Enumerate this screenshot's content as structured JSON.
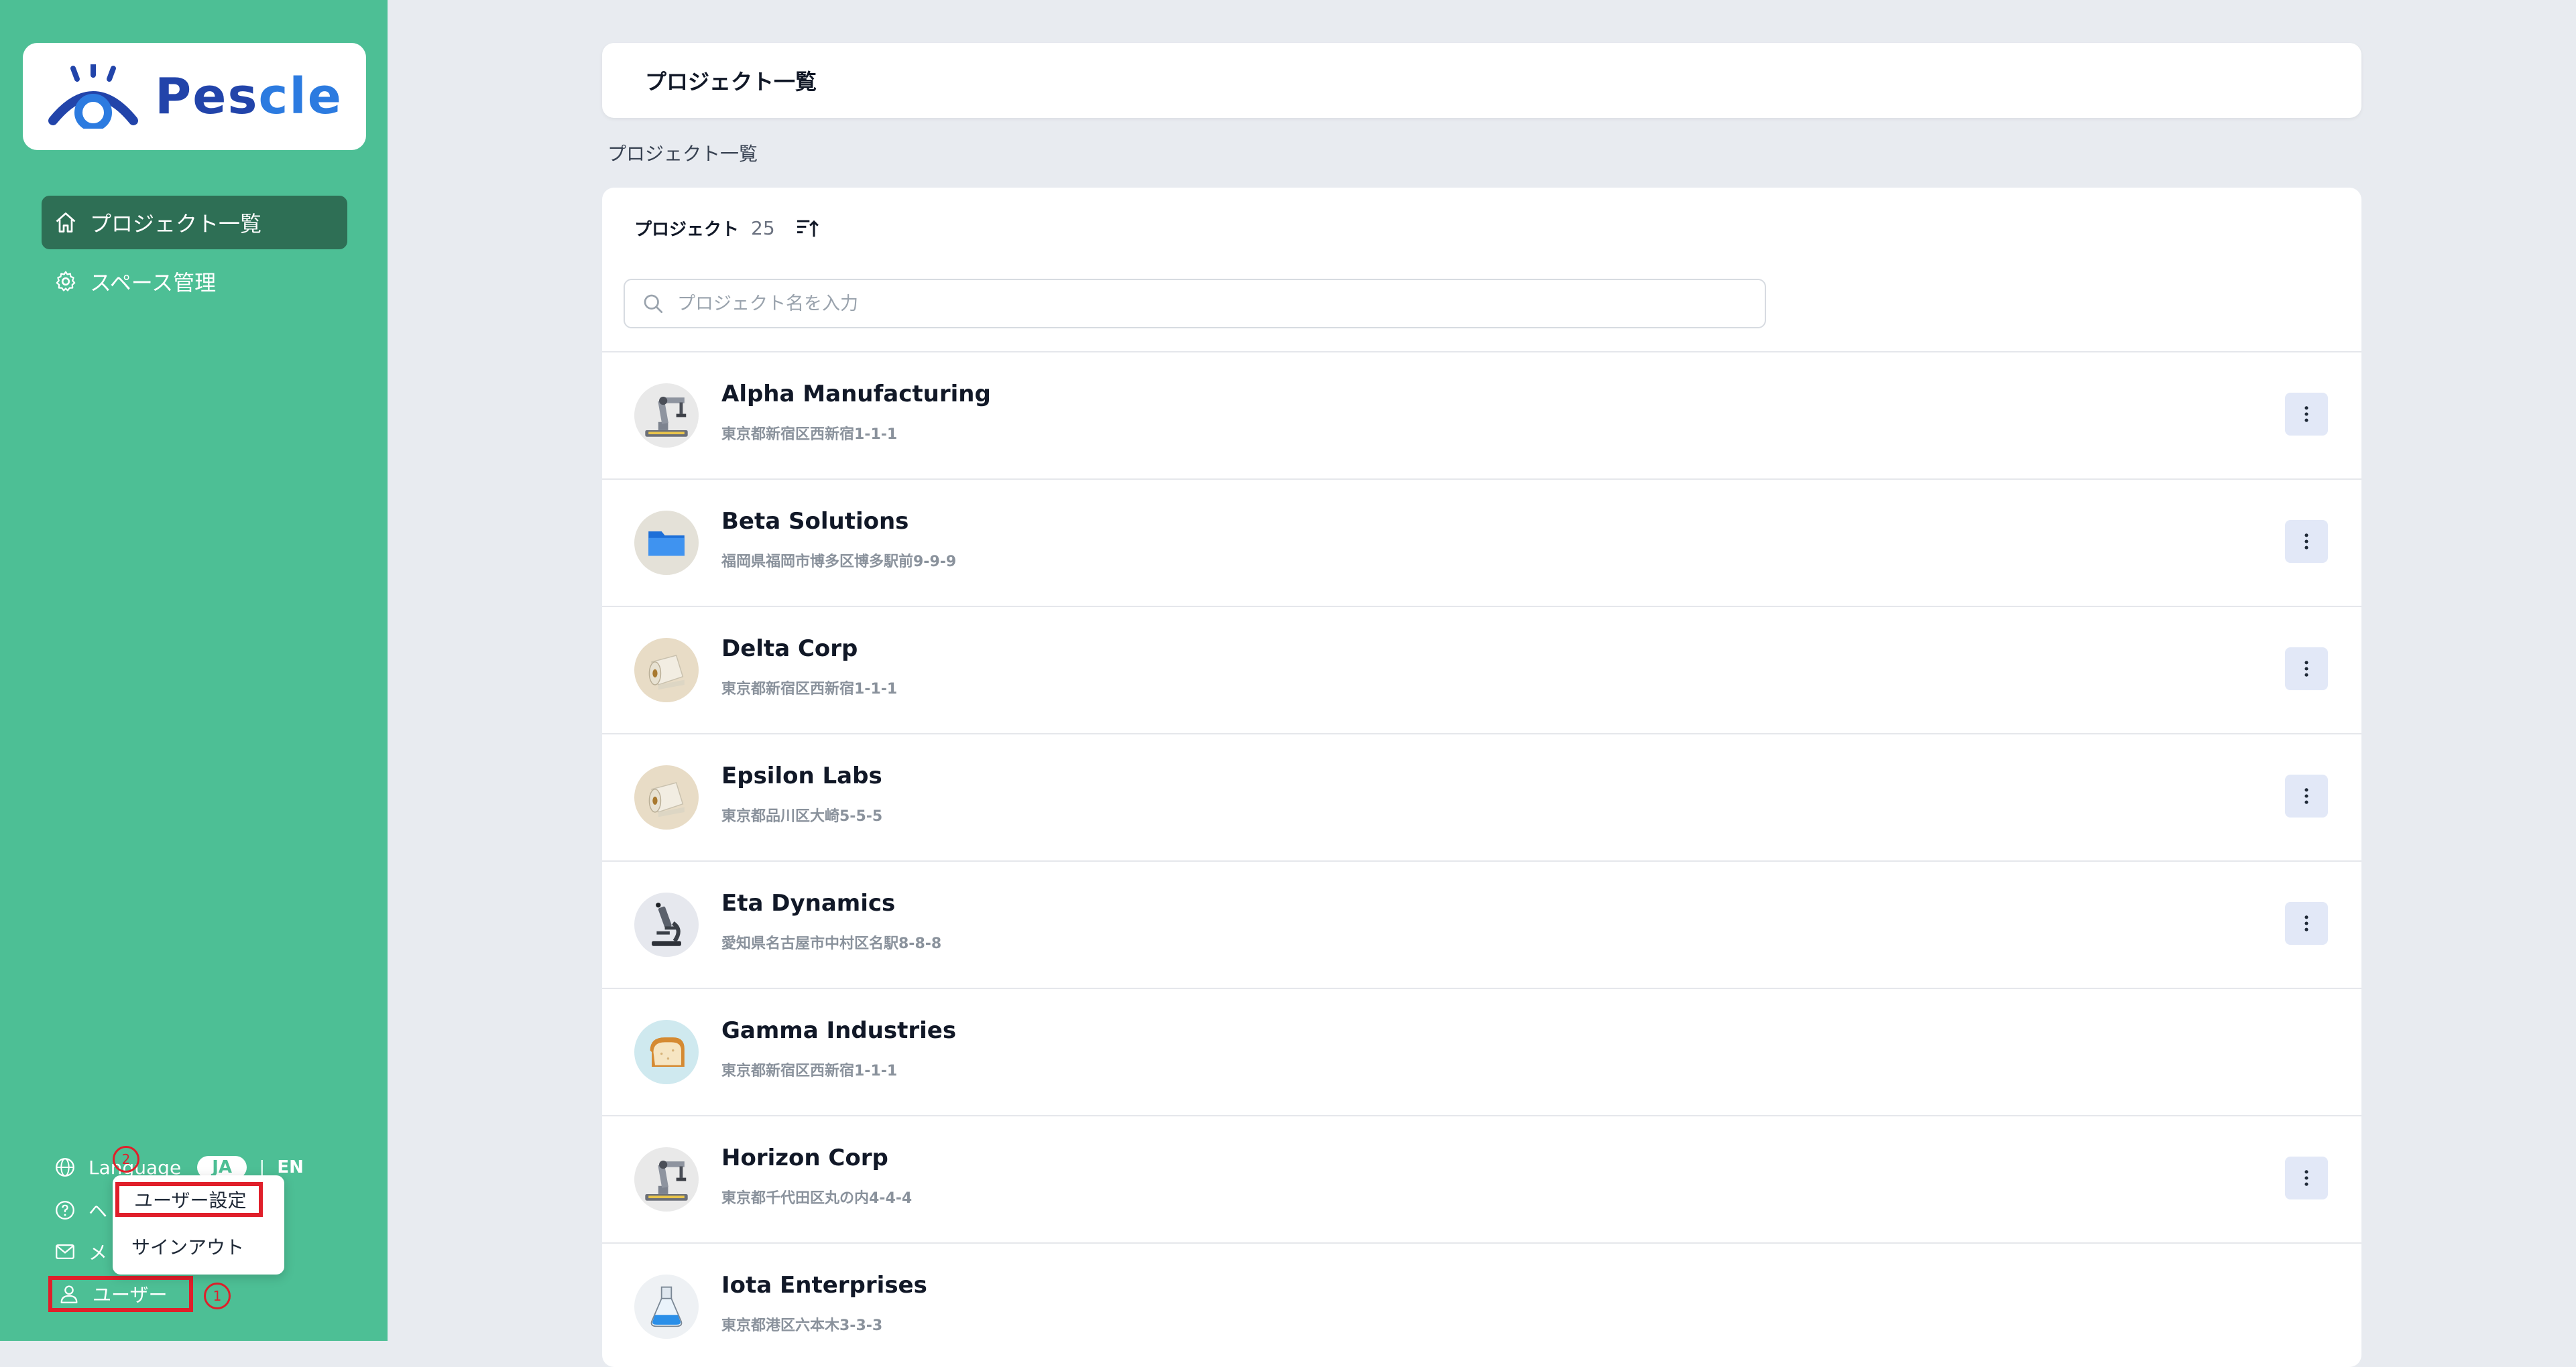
{
  "brand": {
    "name_a": "Pes",
    "name_b": "cle"
  },
  "sidebar": {
    "nav": [
      {
        "label": "プロジェクト一覧",
        "icon": "home-icon",
        "active": true
      },
      {
        "label": "スペース管理",
        "icon": "gear-icon",
        "active": false
      }
    ],
    "language": {
      "label": "Language",
      "ja": "JA",
      "sep": "|",
      "en": "EN"
    },
    "help_label": "ヘ",
    "mail_label": "メ",
    "user_label": "ユーザー",
    "markers": {
      "one": "1",
      "two": "2"
    },
    "popup": {
      "settings": "ユーザー設定",
      "signout": "サインアウト"
    }
  },
  "header": {
    "title": "プロジェクト一覧"
  },
  "breadcrumb": "プロジェクト一覧",
  "list": {
    "label": "プロジェクト",
    "count": "25",
    "search_placeholder": "プロジェクト名を入力",
    "rows": [
      {
        "name": "Alpha Manufacturing",
        "address": "東京都新宿区西新宿1-1-1",
        "icon": "robot-arm-icon",
        "bg": "#e9e9e9",
        "menu": true
      },
      {
        "name": "Beta Solutions",
        "address": "福岡県福岡市博多区博多駅前9-9-9",
        "icon": "folder-icon",
        "bg": "#e4e1d8",
        "menu": true
      },
      {
        "name": "Delta Corp",
        "address": "東京都新宿区西新宿1-1-1",
        "icon": "paper-roll-icon",
        "bg": "#e8dcc6",
        "menu": true
      },
      {
        "name": "Epsilon Labs",
        "address": "東京都品川区大崎5-5-5",
        "icon": "paper-roll-icon",
        "bg": "#e8dcc6",
        "menu": true
      },
      {
        "name": "Eta Dynamics",
        "address": "愛知県名古屋市中村区名駅8-8-8",
        "icon": "microscope-icon",
        "bg": "#e6e8ee",
        "menu": true
      },
      {
        "name": "Gamma Industries",
        "address": "東京都新宿区西新宿1-1-1",
        "icon": "bread-icon",
        "bg": "#cfe9ef",
        "menu": false
      },
      {
        "name": "Horizon Corp",
        "address": "東京都千代田区丸の内4-4-4",
        "icon": "robot-arm-icon",
        "bg": "#e9e9e9",
        "menu": true
      },
      {
        "name": "Iota Enterprises",
        "address": "東京都港区六本木3-3-3",
        "icon": "flask-icon",
        "bg": "#eef1f4",
        "menu": false
      }
    ]
  },
  "colors": {
    "sidebar": "#4dbf95",
    "active_nav": "#2e6f55",
    "highlight": "#e01f2a",
    "kebab_bg": "#e2e8f7"
  }
}
